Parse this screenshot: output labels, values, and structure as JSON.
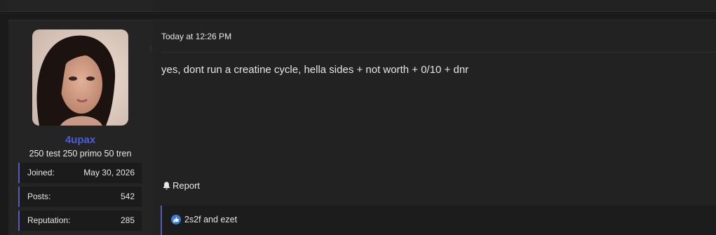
{
  "user": {
    "name": "4upax",
    "title": "250 test 250 primo 50 tren",
    "stats": [
      {
        "label": "Joined:",
        "value": "May 30, 2026"
      },
      {
        "label": "Posts:",
        "value": "542"
      },
      {
        "label": "Reputation:",
        "value": "285"
      }
    ]
  },
  "post": {
    "time": "Today at 12:26 PM",
    "body": "yes, dont run a creatine cycle, hella sides + not worth + 0/10 + dnr",
    "report_label": "Report",
    "reactions": "2s2f and ezet"
  },
  "colors": {
    "accent": "#5a59b8",
    "username": "#4b5ed6"
  },
  "icons": [
    "bell-icon",
    "like-icon"
  ]
}
